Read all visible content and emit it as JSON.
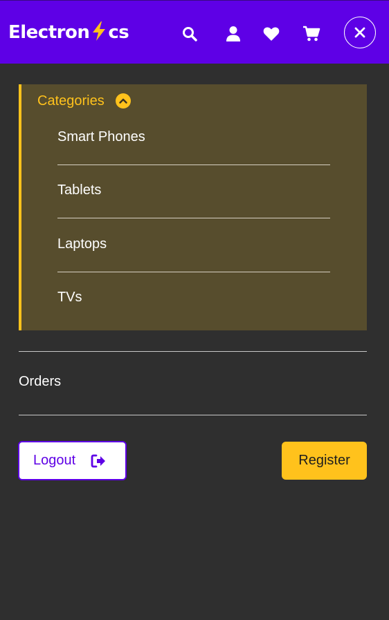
{
  "brand": {
    "prefix": "Electron",
    "suffix": "cs"
  },
  "header_icons": [
    "search-icon",
    "user-icon",
    "heart-icon",
    "cart-icon",
    "close-icon"
  ],
  "categories": {
    "title": "Categories",
    "items": [
      {
        "label": "Smart Phones"
      },
      {
        "label": "Tablets"
      },
      {
        "label": "Laptops"
      },
      {
        "label": "TVs"
      }
    ]
  },
  "menu": {
    "orders_label": "Orders"
  },
  "actions": {
    "logout_label": "Logout",
    "register_label": "Register"
  },
  "colors": {
    "brand_purple": "#5e00e6",
    "accent_yellow": "#ffc21c",
    "background": "#2f2f2f",
    "panel": "#574d2d"
  }
}
